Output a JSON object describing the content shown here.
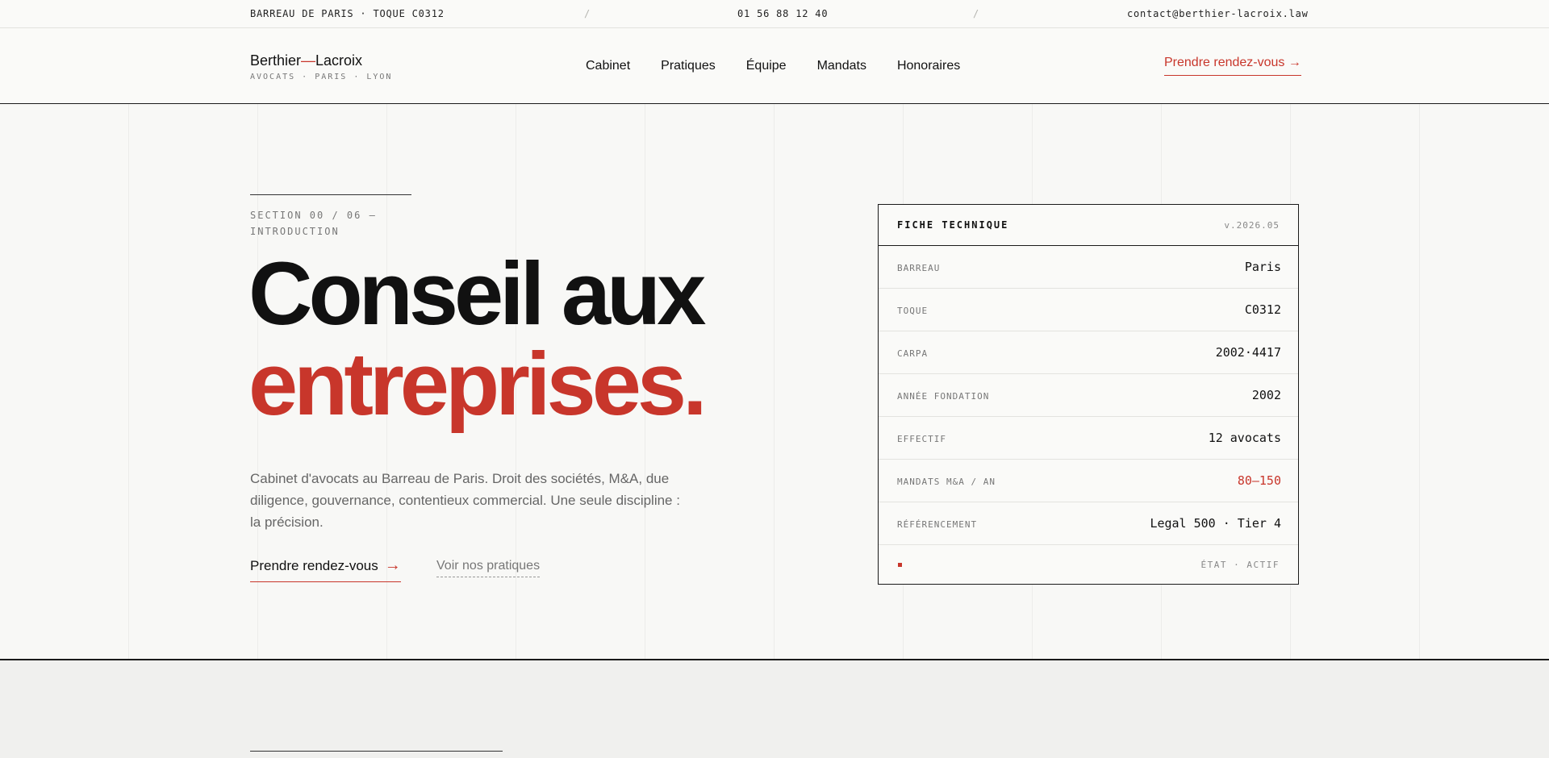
{
  "topbar": {
    "bar_info": "BARREAU DE PARIS · TOQUE C0312",
    "separator": "/",
    "phone": "01 56 88 12 40",
    "email": "contact@berthier-lacroix.law"
  },
  "brand": {
    "name_part1": "Berthier",
    "dash": "—",
    "name_part2": "Lacroix",
    "subtitle": "AVOCATS · PARIS · LYON"
  },
  "nav": {
    "items": [
      {
        "label": "Cabinet"
      },
      {
        "label": "Pratiques"
      },
      {
        "label": "Équipe"
      },
      {
        "label": "Mandats"
      },
      {
        "label": "Honoraires"
      }
    ],
    "cta": "Prendre rendez-vous →"
  },
  "hero": {
    "eyebrow": "SECTION 00 / 06 — INTRODUCTION",
    "headline_line1": "Conseil aux",
    "headline_line2": "entreprises.",
    "lead": "Cabinet d'avocats au Barreau de Paris. Droit des sociétés, M&A, due diligence, gouvernance, contentieux commercial. Une seule discipline : la précision.",
    "primary_cta": "Prendre rendez-vous",
    "primary_cta_arrow": "→",
    "secondary_cta": "Voir nos pratiques"
  },
  "spec_card": {
    "title": "FICHE TECHNIQUE",
    "version": "v.2026.05",
    "rows": [
      {
        "key": "BARREAU",
        "value": "Paris"
      },
      {
        "key": "TOQUE",
        "value": "C0312"
      },
      {
        "key": "CARPA",
        "value": "2002·4417"
      },
      {
        "key": "ANNÉE FONDATION",
        "value": "2002"
      },
      {
        "key": "EFFECTIF",
        "value": "12 avocats"
      },
      {
        "key": "MANDATS M&A / AN",
        "value": "80–150"
      },
      {
        "key": "RÉFÉRENCEMENT",
        "value": "Legal 500 · Tier 4"
      }
    ],
    "status": "ÉTAT · ACTIF"
  },
  "colors": {
    "accent": "#c8362b",
    "ink": "#111111",
    "background": "#fafaf8"
  }
}
